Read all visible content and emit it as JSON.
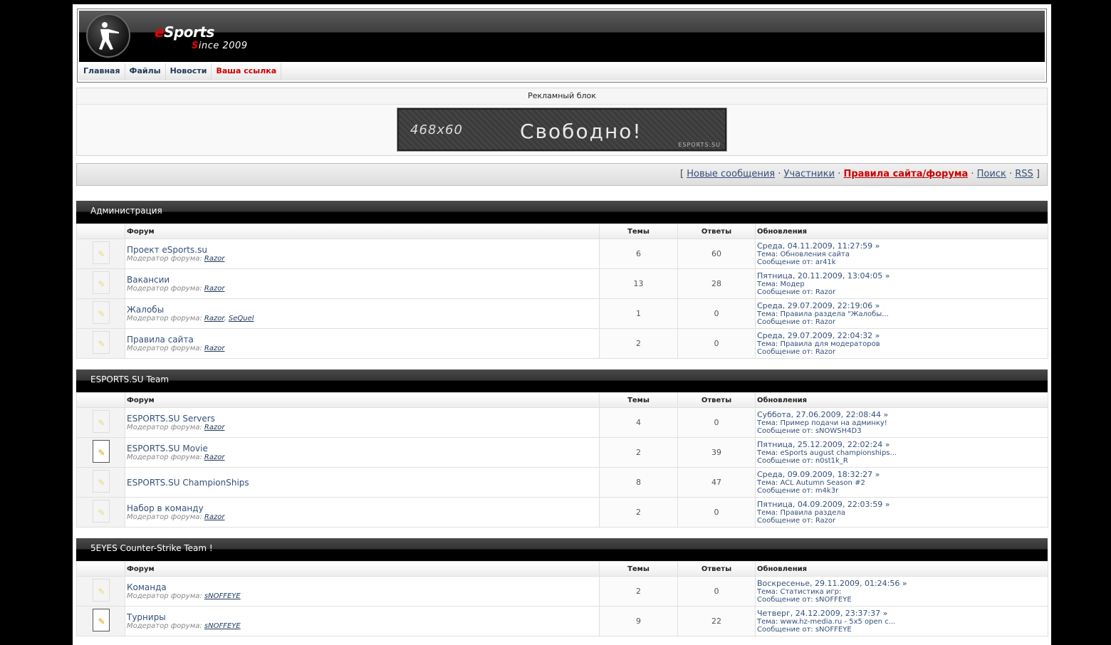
{
  "header": {
    "logo_e": "e",
    "logo_rest": "Sports",
    "logo_since_s": "S",
    "logo_since_rest": "ince 2009"
  },
  "nav": [
    "Главная",
    "Файлы",
    "Новости",
    "Ваша ссылка"
  ],
  "ad": {
    "title": "Рекламный блок",
    "banner_size": "468x60",
    "banner_text": "Свободно!",
    "banner_mark": "ESPORTS.SU"
  },
  "links": {
    "items": [
      "Новые сообщения",
      "Участники",
      "Правила сайта/форума",
      "Поиск",
      "RSS"
    ]
  },
  "columns": {
    "forum": "Форум",
    "topics": "Темы",
    "replies": "Ответы",
    "updates": "Обновления"
  },
  "mod_label": "Модератор форума:",
  "labels": {
    "topic": "Тема:",
    "from": "Сообщение от:"
  },
  "categories": [
    {
      "title": "Администрация",
      "forums": [
        {
          "name": "Проект eSports.su",
          "mods": [
            "Razor"
          ],
          "topics": "6",
          "replies": "60",
          "date": "Среда, 04.11.2009, 11:27:59",
          "topic": "Обновления сайта",
          "author": "ar41k"
        },
        {
          "name": "Вакансии",
          "mods": [
            "Razor"
          ],
          "topics": "13",
          "replies": "28",
          "date": "Пятница, 20.11.2009, 13:04:05",
          "topic": "Модер",
          "author": "Razor"
        },
        {
          "name": "Жалобы",
          "mods": [
            "Razor",
            "SeQuel"
          ],
          "topics": "1",
          "replies": "0",
          "date": "Среда, 29.07.2009, 22:19:06",
          "topic": "Правила раздела \"Жалобы...",
          "author": "Razor"
        },
        {
          "name": "Правила сайта",
          "mods": [
            "Razor"
          ],
          "topics": "2",
          "replies": "0",
          "date": "Среда, 29.07.2009, 22:04:32",
          "topic": "Правила для модераторов",
          "author": "Razor"
        }
      ]
    },
    {
      "title": "ESPORTS.SU Team",
      "forums": [
        {
          "name": "ESPORTS.SU Servers",
          "mods": [
            "Razor"
          ],
          "topics": "4",
          "replies": "0",
          "date": "Суббота, 27.06.2009, 22:08:44",
          "topic": "Пример подачи на админку!",
          "author": "sNOWSH4D3"
        },
        {
          "name": "ESPORTS.SU Movie",
          "mods": [
            "Razor"
          ],
          "topics": "2",
          "replies": "39",
          "date": "Пятница, 25.12.2009, 22:02:24",
          "topic": "eSports august championships...",
          "author": "n0st1k_R",
          "new": true
        },
        {
          "name": "ESPORTS.SU ChampionShips",
          "mods": [],
          "topics": "8",
          "replies": "47",
          "date": "Среда, 09.09.2009, 18:32:27",
          "topic": "ACL Autumn Season #2",
          "author": "m4k3r"
        },
        {
          "name": "Набор в команду",
          "mods": [
            "Razor"
          ],
          "topics": "2",
          "replies": "0",
          "date": "Пятница, 04.09.2009, 22:03:59",
          "topic": "Правила раздела",
          "author": "Razor"
        }
      ]
    },
    {
      "title": "5EYES Counter-Strike Team !",
      "forums": [
        {
          "name": "Команда",
          "mods": [
            "sNOFFEYE"
          ],
          "topics": "2",
          "replies": "0",
          "date": "Воскресенье, 29.11.2009, 01:24:56",
          "topic": "Статистика игр:",
          "author": "sNOFFEYE"
        },
        {
          "name": "Турниры",
          "mods": [
            "sNOFFEYE"
          ],
          "topics": "9",
          "replies": "22",
          "date": "Четверг, 24.12.2009, 23:37:37",
          "topic": "www.hz-media.ru - 5x5 open c...",
          "author": "sNOFFEYE",
          "new": true
        }
      ]
    }
  ]
}
